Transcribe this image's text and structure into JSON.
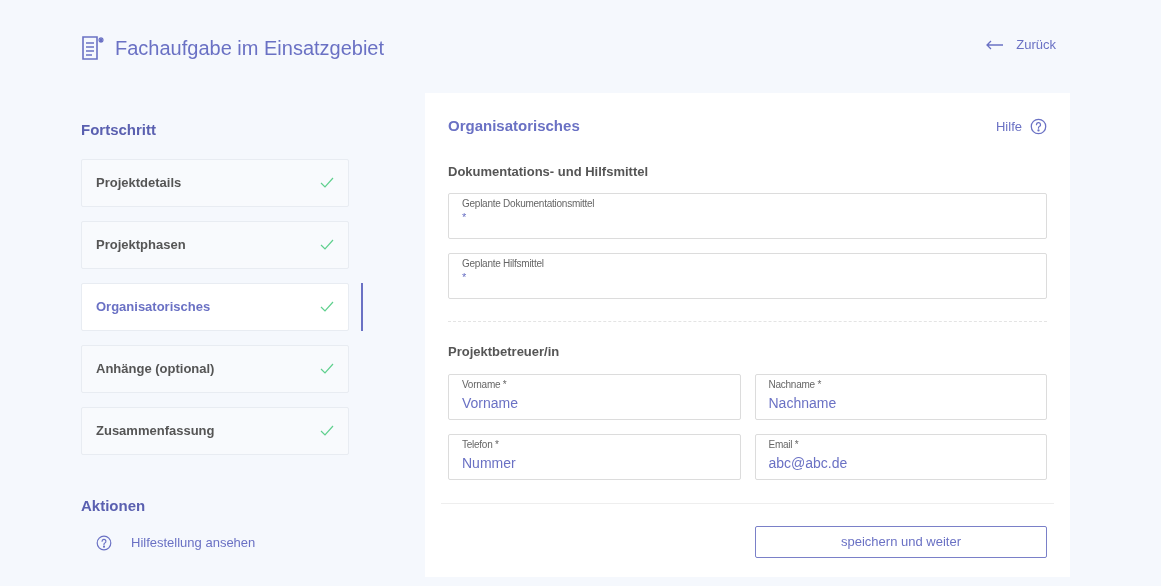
{
  "header": {
    "title": "Fachaufgabe im Einsatzgebiet",
    "back_link": "Zurück"
  },
  "sidebar": {
    "heading": "Fortschritt",
    "steps": [
      {
        "label": "Projektdetails",
        "done": true,
        "selected": false
      },
      {
        "label": "Projektphasen",
        "done": true,
        "selected": false
      },
      {
        "label": "Organisatorisches",
        "done": true,
        "selected": true
      },
      {
        "label": "Anhänge (optional)",
        "done": true,
        "selected": false
      },
      {
        "label": "Zusammenfassung",
        "done": true,
        "selected": false
      }
    ],
    "actions_heading": "Aktionen",
    "actions": [
      {
        "label": "Hilfestellung ansehen"
      }
    ]
  },
  "form": {
    "title": "Organisatorisches",
    "help_link": "Hilfe",
    "sections": [
      {
        "heading": "Dokumentations- und Hilfsmittel",
        "kind": "stacked",
        "fields": [
          {
            "label": "Geplante Dokumentationsmittel",
            "required_mark": "*"
          },
          {
            "label": "Geplante Hilfsmittel",
            "required_mark": "*"
          }
        ]
      },
      {
        "heading": "Projektbetreuer/in",
        "kind": "grid",
        "fields": [
          {
            "label": "Vorname *",
            "placeholder": "Vorname"
          },
          {
            "label": "Nachname *",
            "placeholder": "Nachname"
          },
          {
            "label": "Telefon *",
            "placeholder": "Nummer"
          },
          {
            "label": "Email *",
            "placeholder": "abc@abc.de"
          }
        ]
      }
    ],
    "submit_button": "speichern und weiter"
  }
}
